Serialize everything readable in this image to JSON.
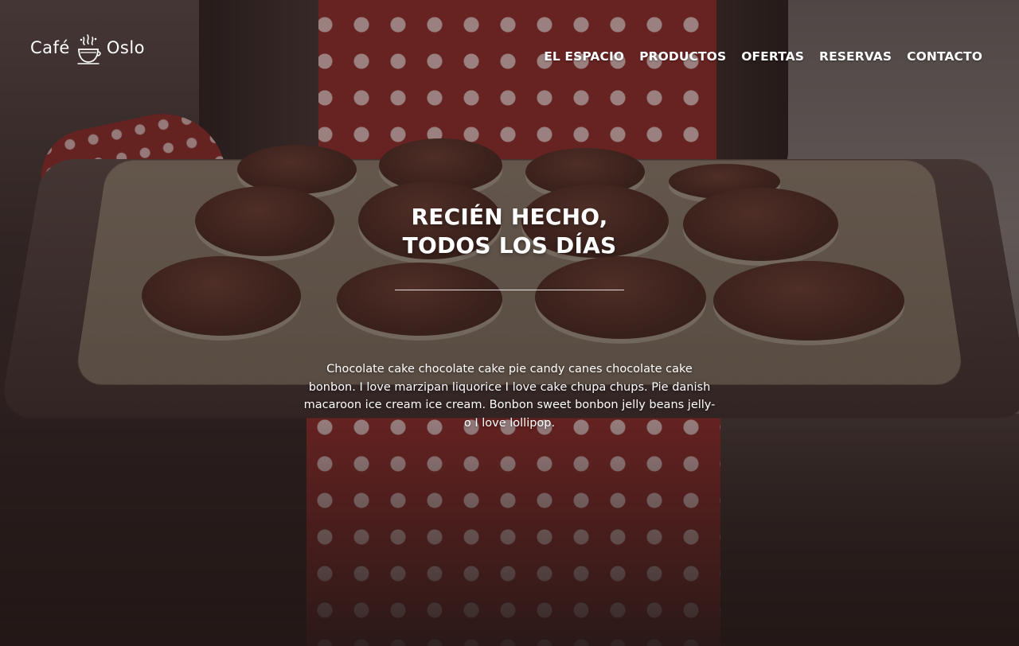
{
  "logo": {
    "left": "Café",
    "right": "Oslo",
    "icon": "coffee-cup-icon"
  },
  "nav": {
    "items": [
      {
        "label": "EL ESPACIO"
      },
      {
        "label": "PRODUCTOS"
      },
      {
        "label": "OFERTAS"
      },
      {
        "label": "RESERVAS"
      },
      {
        "label": "CONTACTO"
      }
    ]
  },
  "hero": {
    "title_line1": "RECIÉN HECHO,",
    "title_line2": "TODOS LOS DÍAS",
    "body": "Chocolate cake chocolate cake pie candy canes chocolate cake bonbon. I love marzipan liquorice I love cake chupa chups. Pie danish macaroon ice cream ice cream. Bonbon sweet bonbon jelly beans jelly-o I love lollipop."
  },
  "colors": {
    "text": "#ffffff",
    "apron": "#8f2d2b",
    "muffin": "#4e2c24"
  }
}
